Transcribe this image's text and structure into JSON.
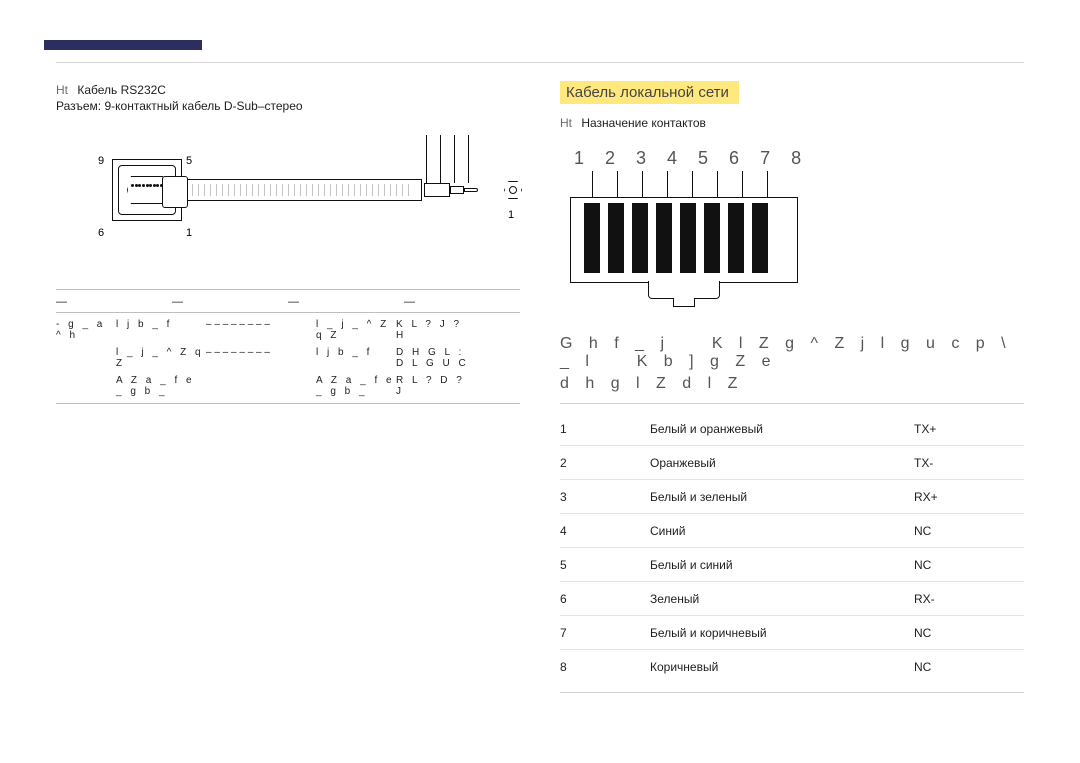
{
  "left": {
    "bullet_prefix": "Ht",
    "title": "Кабель RS232C",
    "subtitle": "Разъем: 9-контактный кабель D-Sub–стерео",
    "pin_labels": {
      "p9": "9",
      "p5": "5",
      "p6": "6",
      "p1a": "1",
      "p1b": "1"
    },
    "hdr": {
      "a": "—",
      "b": "—",
      "c": "—",
      "d": "—"
    },
    "rows": [
      {
        "c1": "- g _ a ^ h",
        "c2": "l j b _ f",
        "c3": "– – – – – – – –",
        "c4": "l _ j _ ^ Z q Z",
        "c5": "K L ? J ? H"
      },
      {
        "c1": "",
        "c2": "l _ j _ ^ Z q Z",
        "c3": "– – – – – – – –",
        "c4": "l j b _ f",
        "c5": "D H G L : D L G U C"
      },
      {
        "c1": "",
        "c2": "A Z a _ f e _ g b _",
        "c3": "",
        "c4": "A Z a _ f e _ g b _",
        "c5": "R L ? D ? J"
      }
    ]
  },
  "right": {
    "heading": "Кабель локальной сети",
    "bullet_prefix": "Ht",
    "bullet": "Назначение контактов",
    "pin_numbers": "1 2 3 4 5 6 7 8",
    "table_head": {
      "l1a": "G h f _ j",
      "l1b": "K l Z g ^ Z j l g u c  p \\ _ l",
      "l1c": "K b ] g Z e",
      "l2": "d h g l Z d l Z"
    },
    "rows": [
      {
        "n": "1",
        "c": "Белый и оранжевый",
        "s": "TX+"
      },
      {
        "n": "2",
        "c": "Оранжевый",
        "s": "TX-"
      },
      {
        "n": "3",
        "c": "Белый и зеленый",
        "s": "RX+"
      },
      {
        "n": "4",
        "c": "Синий",
        "s": "NC"
      },
      {
        "n": "5",
        "c": "Белый и синий",
        "s": "NC"
      },
      {
        "n": "6",
        "c": "Зеленый",
        "s": "RX-"
      },
      {
        "n": "7",
        "c": "Белый и коричневый",
        "s": "NC"
      },
      {
        "n": "8",
        "c": "Коричневый",
        "s": "NC"
      }
    ]
  }
}
